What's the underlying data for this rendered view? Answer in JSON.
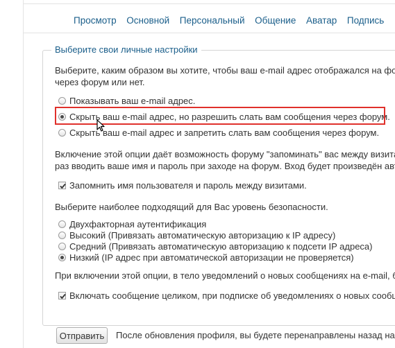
{
  "tabs": [
    "Просмотр",
    "Основной",
    "Персональный",
    "Общение",
    "Аватар",
    "Подпись"
  ],
  "legend": "Выберите свои личные настройки",
  "email_prompt": [
    "Выберите, каким образом вы хотите, чтобы ваш e-mail адрес отображался на фор",
    "через форум или нет."
  ],
  "email_options": [
    {
      "label": "Показывать ваш e-mail адрес.",
      "selected": false
    },
    {
      "label": "Скрыть ваш e-mail адрес, но разрешить слать вам сообщения через форум.",
      "selected": true
    },
    {
      "label": "Скрыть ваш e-mail адрес и запретить слать вам сообщения через форум.",
      "selected": false
    }
  ],
  "remember_info": [
    "Включение этой опции даёт возможность форуму \"запоминать\" вас между визитам",
    "раз вводить ваше имя и пароль при заходе на форум. Вход будет произведён авто"
  ],
  "remember_checkbox": {
    "label": "Запомнить имя пользователя и пароль между визитами.",
    "checked": true
  },
  "security_prompt": "Выберите наиболее подходящий для Вас уровень безопасности.",
  "security_options": [
    {
      "label": "Двухфакторная аутентификация",
      "selected": false
    },
    {
      "label": "Высокий (Привязать автоматическую авторизацию к IP адресу)",
      "selected": false
    },
    {
      "label": "Средний (Привязать автоматическую авторизацию к подсети IP адреса)",
      "selected": false
    },
    {
      "label": "Низкий (IP адрес при автоматической авторизации не проверяется)",
      "selected": true
    }
  ],
  "notify_info": "При включении этой опции, в тело уведомлений о новых сообщениях на e-mail, б",
  "notify_checkbox": {
    "label": "Включать сообщение целиком, при подписке об уведомлениях о новых сообще",
    "checked": true
  },
  "submit_label": "Отправить",
  "after_submit": "После обновления профиля, вы будете перенаправлены назад на эта"
}
